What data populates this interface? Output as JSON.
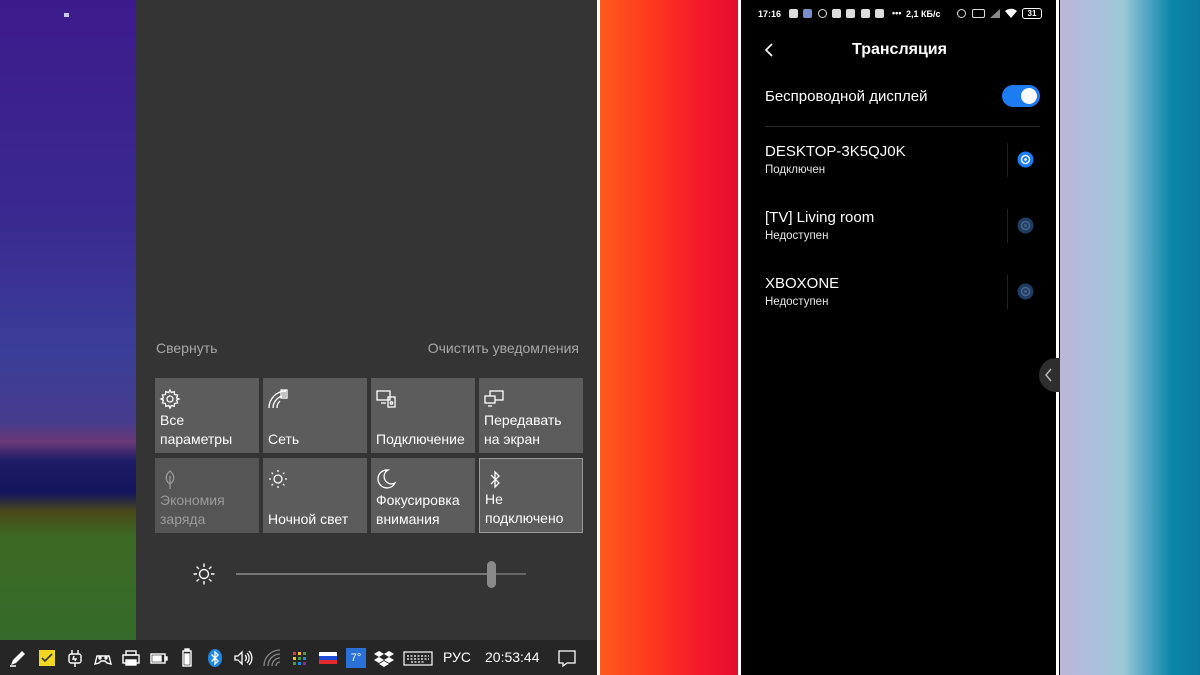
{
  "action_center": {
    "collapse_label": "Свернуть",
    "clear_label": "Очистить уведомления",
    "tiles": [
      {
        "label": "Все параметры",
        "icon": "gear-icon",
        "state": "on"
      },
      {
        "label": "Сеть",
        "icon": "network-icon",
        "state": "on"
      },
      {
        "label": "Подключение",
        "icon": "connect-icon",
        "state": "on"
      },
      {
        "label": "Передавать на экран",
        "icon": "project-icon",
        "state": "on"
      },
      {
        "label": "Экономия заряда",
        "icon": "battery-saver-icon",
        "state": "disabled"
      },
      {
        "label": "Ночной свет",
        "icon": "night-light-icon",
        "state": "on"
      },
      {
        "label": "Фокусировка внимания",
        "icon": "moon-icon",
        "state": "on"
      },
      {
        "label": "Не подключено",
        "icon": "bluetooth-icon",
        "state": "active"
      }
    ],
    "brightness_percent": 88
  },
  "taskbar": {
    "icons": [
      "pen-icon",
      "sticky-notes-icon",
      "power-plug-icon",
      "gamepad-icon",
      "printer-icon",
      "battery-charging-icon",
      "battery-icon",
      "bluetooth-icon",
      "volume-icon",
      "wifi-icon",
      "equalizer-icon",
      "russia-flag-icon",
      "weather-icon",
      "dropbox-icon",
      "keyboard-icon"
    ],
    "weather_temp": "7°",
    "language": "РУС",
    "clock": "20:53:44"
  },
  "phone": {
    "status": {
      "time": "17:16",
      "speed": "2,1 КБ/с",
      "battery": "31"
    },
    "title": "Трансляция",
    "wireless_display_label": "Беспроводной дисплей",
    "wireless_display_on": true,
    "devices": [
      {
        "name": "DESKTOP-3K5QJ0K",
        "status": "Подключен",
        "connected": true
      },
      {
        "name": "[TV] Living room",
        "status": "Недоступен",
        "connected": false
      },
      {
        "name": "XBOXONE",
        "status": "Недоступен",
        "connected": false
      }
    ]
  },
  "colors": {
    "action_center_bg": "#343434",
    "tile_bg": "#5c5c5c",
    "taskbar_bg": "#262626",
    "toggle_blue": "#1d7cf2"
  }
}
